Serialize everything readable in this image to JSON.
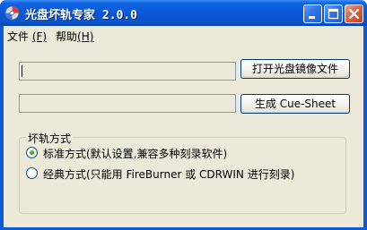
{
  "window": {
    "title": "光盘坏轨专家 2.0.0"
  },
  "menu": {
    "file_label": "文件",
    "file_accel": "(F)",
    "help_label": "帮助",
    "help_accel": "(H)"
  },
  "main": {
    "image_path_value": "",
    "cue_path_value": "",
    "open_image_button": "打开光盘镜像文件",
    "generate_cue_button": "生成 Cue-Sheet"
  },
  "method_group": {
    "title": "坏轨方式",
    "standard_option": "标准方式(默认设置,兼容多种刻录软件)",
    "classic_option": "经典方式(只能用 FireBurner 或 CDRWIN 进行刻录)",
    "selected": "standard"
  },
  "colors": {
    "titlebar": "#0a5bd8",
    "client_bg": "#ece9d8",
    "close_button": "#e0633f",
    "radio_dot": "#21a121"
  }
}
